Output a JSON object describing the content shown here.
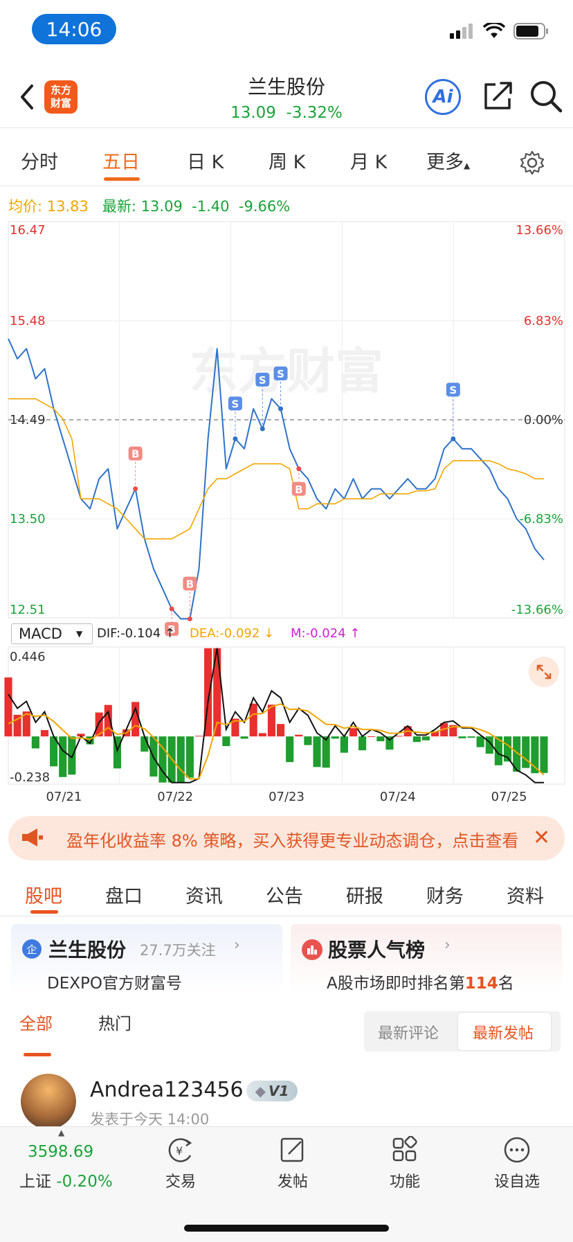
{
  "status_bar": {
    "time": "14:06"
  },
  "header": {
    "logo_line1": "东方",
    "logo_line2": "财富",
    "title": "兰生股份",
    "price": "13.09",
    "change": "-3.32%",
    "ai_label": "Ai"
  },
  "period_tabs": [
    "分时",
    "五日",
    "日 K",
    "周 K",
    "月 K",
    "更多"
  ],
  "active_period": "五日",
  "info": {
    "avg_label": "均价:",
    "avg_value": "13.83",
    "latest_label": "最新:",
    "latest_value": "13.09",
    "change_abs": "-1.40",
    "change_pct": "-9.66%"
  },
  "chart_data": {
    "type": "line",
    "price_axis_left": [
      "16.47",
      "15.48",
      "14.49",
      "13.50",
      "12.51"
    ],
    "price_axis_right": [
      "13.66%",
      "6.83%",
      "0.00%",
      "-6.83%",
      "-13.66%"
    ],
    "ylim": [
      12.51,
      16.47
    ],
    "reference_price": 14.49,
    "x_labels": [
      "07/21",
      "07/22",
      "07/23",
      "07/24",
      "07/25"
    ],
    "series": [
      {
        "values": [
          15.3,
          15.1,
          15.2,
          14.9,
          15.0,
          14.6,
          14.3,
          14.0,
          13.7,
          13.6,
          13.9,
          14.0,
          13.4,
          13.6,
          13.8,
          13.3,
          13.0,
          12.8,
          12.6,
          12.5,
          12.5,
          13.0,
          14.3,
          15.2,
          14.0,
          14.3,
          14.2,
          14.6,
          14.4,
          14.7,
          14.6,
          14.2,
          14.0,
          13.9,
          13.7,
          13.6,
          13.8,
          13.7,
          13.9,
          13.7,
          13.8,
          13.8,
          13.7,
          13.8,
          13.9,
          13.8,
          13.8,
          13.9,
          14.2,
          14.3,
          14.2,
          14.2,
          14.1,
          14.0,
          13.8,
          13.7,
          13.5,
          13.4,
          13.2,
          13.09
        ]
      },
      {
        "values": [
          14.7,
          14.7,
          14.7,
          14.7,
          14.65,
          14.6,
          14.5,
          14.3,
          13.7,
          13.7,
          13.7,
          13.65,
          13.6,
          13.5,
          13.4,
          13.3,
          13.3,
          13.3,
          13.3,
          13.35,
          13.4,
          13.6,
          13.8,
          13.9,
          13.9,
          13.95,
          14.0,
          14.05,
          14.05,
          14.05,
          14.05,
          14.0,
          13.6,
          13.6,
          13.65,
          13.65,
          13.65,
          13.7,
          13.7,
          13.7,
          13.7,
          13.75,
          13.75,
          13.75,
          13.75,
          13.78,
          13.78,
          13.8,
          14.0,
          14.08,
          14.08,
          14.08,
          14.08,
          14.08,
          14.05,
          14.0,
          13.98,
          13.95,
          13.9,
          13.9
        ]
      }
    ],
    "buy_markers": [
      "B",
      "B",
      "B",
      "B"
    ],
    "sell_markers": [
      "S",
      "S",
      "S",
      "S"
    ],
    "macd": {
      "indicator": "MACD",
      "dif": "DIF:-0.104 ↑",
      "dea": "DEA:-0.092 ↓",
      "m": "M:-0.024 ↑",
      "ymax_label": "0.446",
      "ymin_label": "-0.238",
      "ylim": [
        -0.238,
        0.446
      ]
    }
  },
  "banner": {
    "text": "盈年化收益率 8% 策略，买入获得更专业动态调仓，点击查看",
    "close": "✕"
  },
  "section_tabs": [
    "股吧",
    "盘口",
    "资讯",
    "公告",
    "研报",
    "财务",
    "资料"
  ],
  "cards": [
    {
      "badge": "企",
      "name": "兰生股份",
      "followers": "27.7万关注",
      "sub": "DEXPO官方财富号"
    },
    {
      "name": "股票人气榜",
      "sub_prefix": "A股市场即时排名第",
      "rank": "114",
      "sub_suffix": "名"
    }
  ],
  "filters": {
    "all": "全部",
    "hot": "热门",
    "latest_comment": "最新评论",
    "latest_post": "最新发帖"
  },
  "post": {
    "user": "Andrea123456",
    "level": "V1",
    "time": "发表于今天 14:00"
  },
  "bottom_nav": {
    "index_value": "3598.69",
    "index_name": "上证",
    "index_change": "-0.20%",
    "items": [
      "交易",
      "发帖",
      "功能",
      "设自选"
    ]
  },
  "colors": {
    "up": "#e3302f",
    "down": "#1aa33a",
    "avg": "#f0a500",
    "price": "#2f72c9",
    "accent": "#ef6a1a"
  }
}
